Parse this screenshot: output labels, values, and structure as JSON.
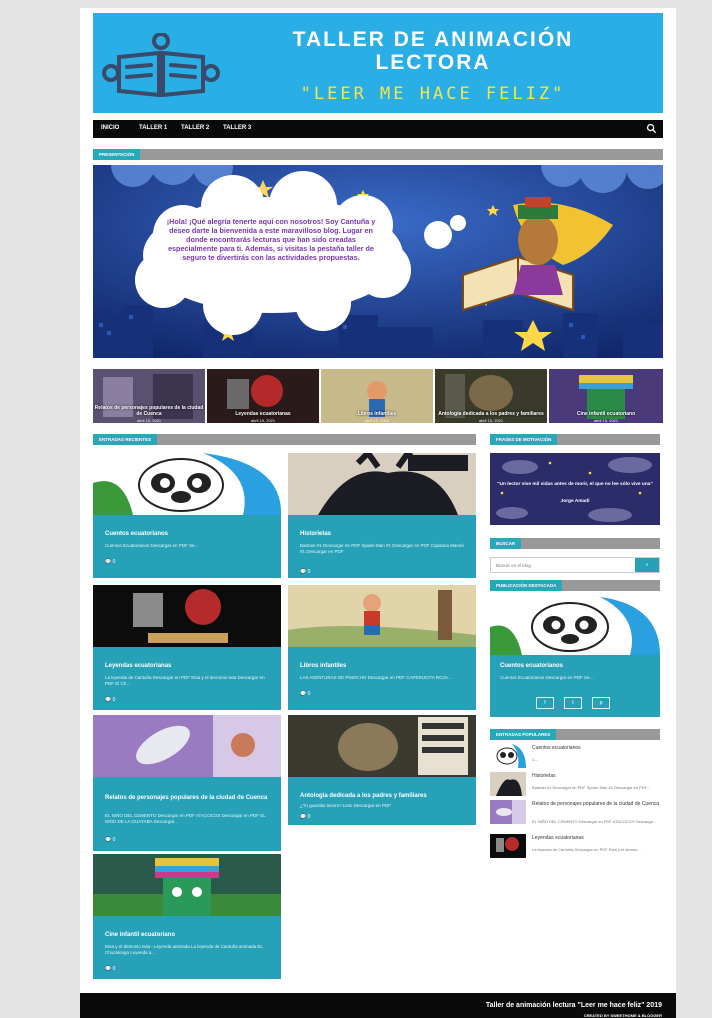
{
  "header": {
    "title_line1": "TALLER DE ANIMACIÓN",
    "title_line2": "LECTORA",
    "tagline": "\"LEER ME HACE FELIZ\""
  },
  "nav": {
    "items": [
      "INICIO",
      "TALLER 1",
      "TALLER 2",
      "TALLER 3"
    ],
    "search_icon": "search-icon"
  },
  "presentation": {
    "label": "PRESENTACIÓN",
    "message": "¡Hola! ¡Qué alegría tenerte aquí con nosotros! Soy Cantuña y deseo darte la bienvenida a este maravilloso blog. Lugar en donde encontrarás lecturas que han sido creadas especialmente para ti. Además, si visitas la pestaña taller de seguro te divertirás con las actividades propuestas."
  },
  "featured": [
    {
      "title": "Relatos de personajes populares de la ciudad de Cuenca",
      "date": "abril 15, 2021"
    },
    {
      "title": "Leyendas ecuatorianas",
      "date": "abril 15, 2021"
    },
    {
      "title": "Libros infantiles",
      "date": "abril 15, 2021"
    },
    {
      "title": "Antología dedicada a los padres y familiares",
      "date": "abril 15, 2021"
    },
    {
      "title": "Cine infantil ecuatoriano",
      "date": "abril 15, 2021"
    }
  ],
  "recent": {
    "label": "ENTRADAS RECIENTES",
    "posts": [
      {
        "title": "Cuentos ecuatorianos",
        "excerpt": "Cuentos Ecuatorianos Descargar en PDF Se...",
        "comments": "0"
      },
      {
        "title": "Historietas",
        "excerpt": "Batman #1 Descargar en PDF Spider-Man #1 Descargar en PDF Capitana Marvel #1 Descargar en PDF",
        "comments": "0"
      },
      {
        "title": "Leyendas ecuatorianas",
        "excerpt": "La leyenda de Cantuña Descargar en PDF Etsa y el demonio Iwia Descargar en PDF El Ch...",
        "comments": "0"
      },
      {
        "title": "Libros infantiles",
        "excerpt": "LAS AVENTURAS DE PINOCHO Descargar en PDF CAPERUCITA ROJA ...",
        "comments": "0"
      },
      {
        "title": "Relatos de personajes populares de la ciudad de Cuenca",
        "excerpt": "EL NIÑO DEL CEMENTO Descargar en PDF ATACOCOS Descargar en PDF EL NIÑO DE LA GUAYABA Descargar...",
        "comments": "0"
      },
      {
        "title": "Antología dedicada a los padres y familiares",
        "excerpt": "¿Tu guardas tesoro? Listo Descargar en PDF",
        "comments": "0"
      },
      {
        "title": "Cine infantil ecuatoriano",
        "excerpt": "Etsa y el demonio Iwia - Leyenda animada La leyenda de Cantuña animada EL Chuzalongo Leyenda a...",
        "comments": "0"
      }
    ]
  },
  "sidebar": {
    "motivation_label": "FRASES DE MOTIVACIÓN",
    "quote": "\"Un lector vive mil vidas antes de morir, el que no lee sólo vive una\"",
    "quote_author": "Jorge Amadí",
    "search_label": "BUSCAR",
    "search_placeholder": "Buscar en el blog",
    "search_button": "⌕",
    "featured_label": "PUBLICACIÓN DESTACADA",
    "featured_title": "Cuentos ecuatorianos",
    "featured_excerpt": "Cuentos Ecuatorianos Descargar en PDF Se...",
    "share": [
      "f",
      "t",
      "p"
    ],
    "popular_label": "ENTRADAS POPULARES",
    "popular": [
      {
        "title": "Cuentos ecuatorianos",
        "excerpt": "C..."
      },
      {
        "title": "Historietas",
        "excerpt": "Batman #1 Descargar en PDF Spider-Man #1 Descargar en PDF..."
      },
      {
        "title": "Relatos de personajes populares de la ciudad de Cuenca",
        "excerpt": "EL NIÑO DEL CEMENTO Descargar en PDF ATACOCOS Descarga..."
      },
      {
        "title": "Leyendas ecuatorianas",
        "excerpt": "La leyenda de Cantuña Descargar en PDF Etsa y el demon..."
      }
    ]
  },
  "footer": {
    "title": "Taller de animación lectura \"Leer me hace feliz\" 2019",
    "credit": "CREATED BY SWEETHOME & BLOGGER"
  },
  "colors": {
    "accent": "#26a1b8",
    "header": "#29aee6",
    "nav": "#0a0a0a"
  }
}
